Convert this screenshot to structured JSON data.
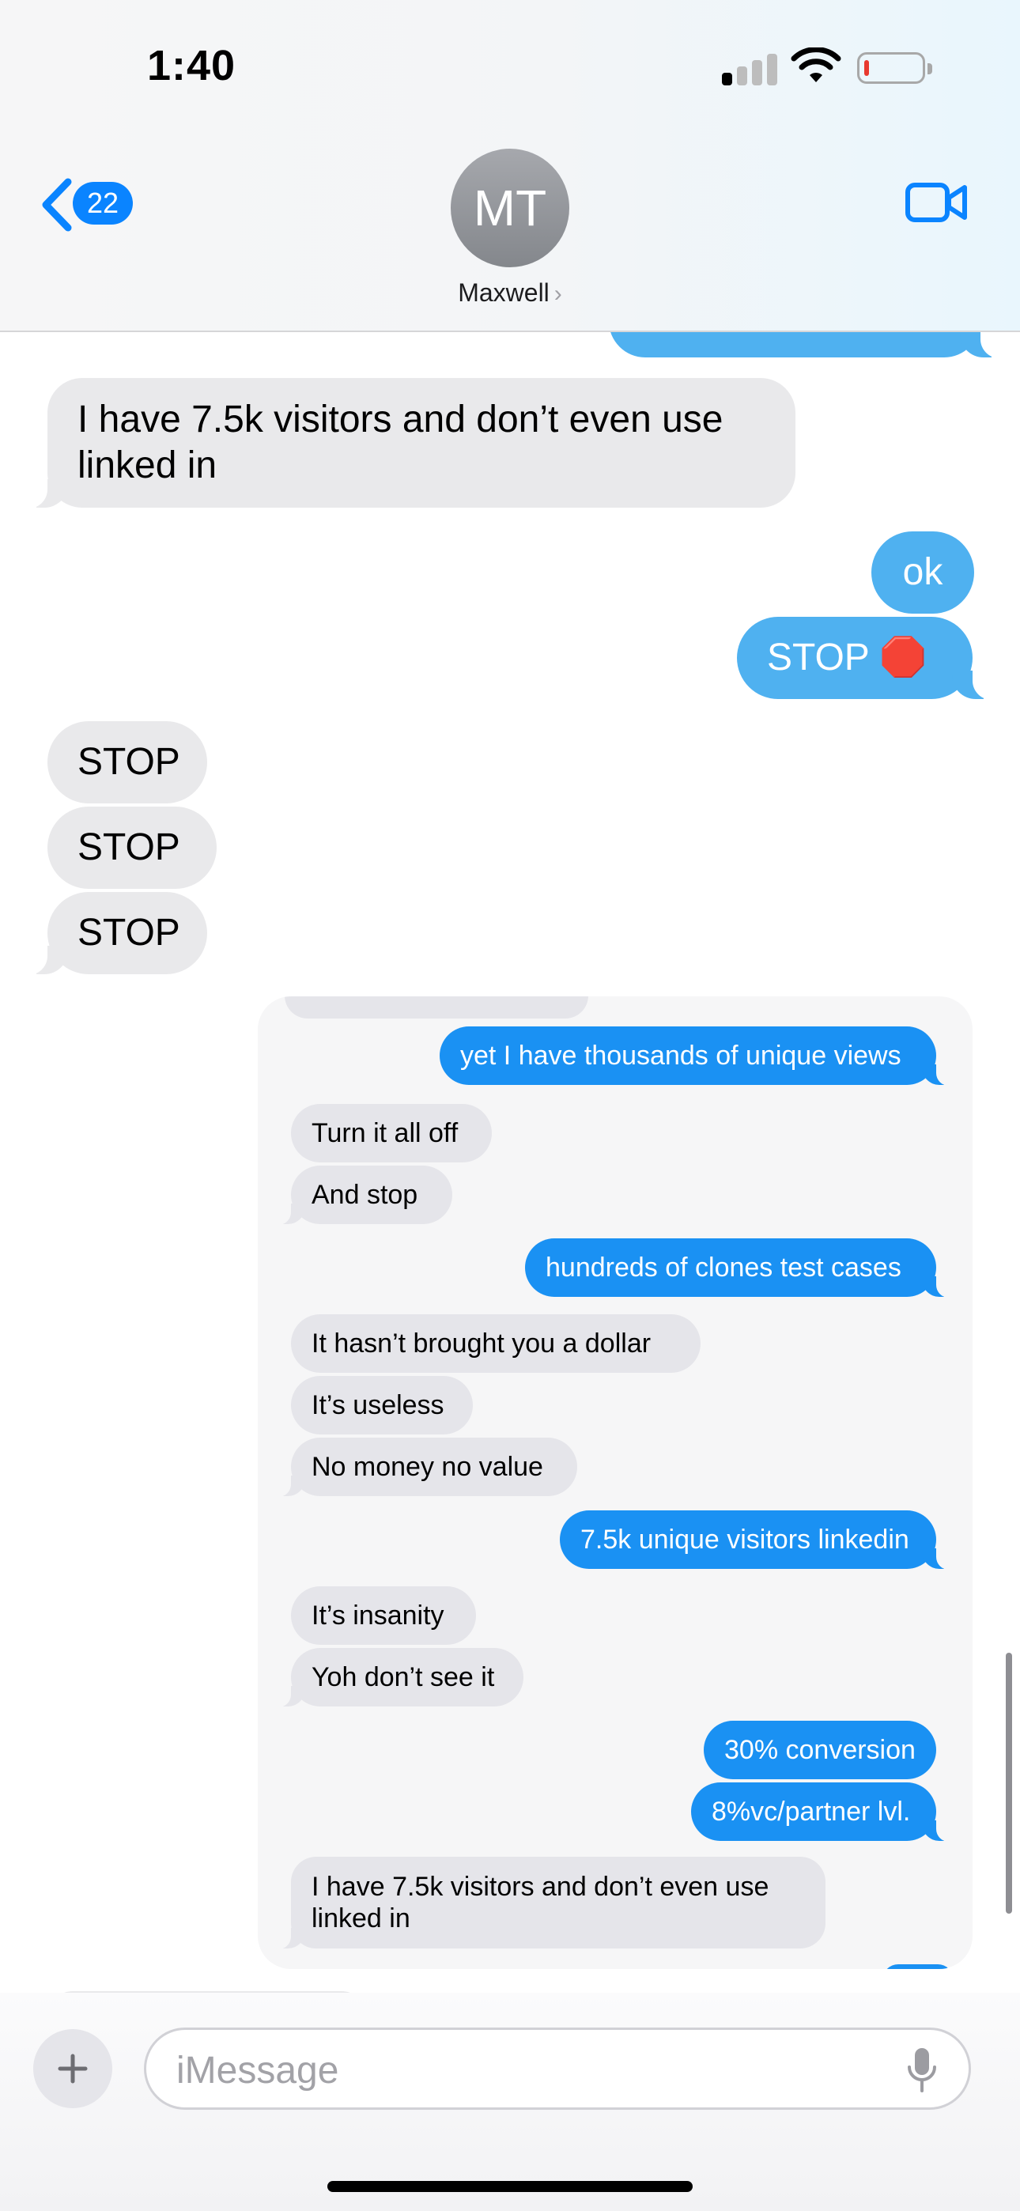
{
  "status_bar": {
    "time": "1:40",
    "icons": [
      "cellular-signal-icon",
      "wifi-icon",
      "battery-low-icon"
    ]
  },
  "header": {
    "back_badge": "22",
    "avatar_initials": "MT",
    "contact_name": "Maxwell",
    "icons": [
      "back-chevron-icon",
      "video-call-icon"
    ]
  },
  "messages": [
    {
      "side": "incoming",
      "text": "I have 7.5k visitors and don’t even use linked in"
    },
    {
      "side": "outgoing",
      "text": "ok"
    },
    {
      "side": "outgoing",
      "text": "STOP 🛑"
    },
    {
      "side": "incoming",
      "text": "STOP"
    },
    {
      "side": "incoming",
      "text": "STOP"
    },
    {
      "side": "incoming",
      "text": "STOP"
    }
  ],
  "screenshot": {
    "messages": [
      {
        "side": "outgoing",
        "text": "yet I have thousands of unique views"
      },
      {
        "side": "incoming",
        "text": "Turn it all off"
      },
      {
        "side": "incoming",
        "text": "And stop"
      },
      {
        "side": "outgoing",
        "text": "hundreds of clones test cases"
      },
      {
        "side": "incoming",
        "text": "It hasn’t brought you a dollar"
      },
      {
        "side": "incoming",
        "text": "It’s useless"
      },
      {
        "side": "incoming",
        "text": "No money no value"
      },
      {
        "side": "outgoing",
        "text": "7.5k unique visitors linkedin"
      },
      {
        "side": "incoming",
        "text": "It’s insanity"
      },
      {
        "side": "incoming",
        "text": "Yoh don’t see it"
      },
      {
        "side": "outgoing",
        "text": "30% conversion"
      },
      {
        "side": "outgoing",
        "text": "8%vc/partner lvl."
      },
      {
        "side": "incoming",
        "text": "I have 7.5k visitors and don’t even use linked in"
      }
    ]
  },
  "composer": {
    "placeholder": "iMessage",
    "icons": [
      "plus-icon",
      "microphone-icon"
    ]
  },
  "colors": {
    "outgoing": "#4fb1f0",
    "incoming": "#e9e9eb",
    "screenshot_outgoing": "#1a91f3",
    "accent": "#0a84ff"
  }
}
